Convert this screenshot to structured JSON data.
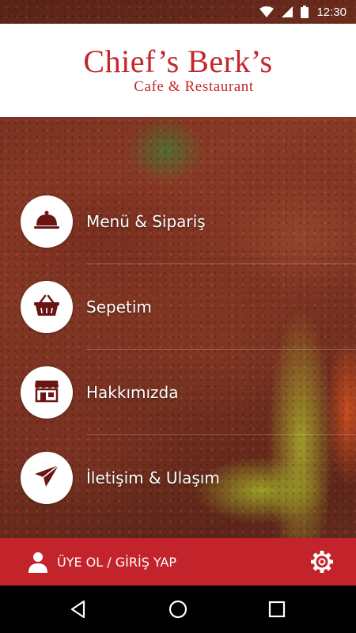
{
  "status_bar": {
    "time": "12:30",
    "icons": [
      "wifi-icon",
      "signal-icon",
      "battery-icon"
    ]
  },
  "header": {
    "brand_name": "Chief’s Berk’s",
    "brand_subtitle": "Cafe & Restaurant",
    "brand_color": "#c3262b"
  },
  "menu": {
    "items": [
      {
        "label": "Menü & Sipariş",
        "icon": "cloche-icon"
      },
      {
        "label": "Sepetim",
        "icon": "basket-icon"
      },
      {
        "label": "Hakkımızda",
        "icon": "storefront-icon"
      },
      {
        "label": "İletişim & Ulaşım",
        "icon": "paper-plane-icon"
      }
    ],
    "icon_color": "#6b1414"
  },
  "account_bar": {
    "label": "ÜYE OL / GİRİŞ YAP",
    "background": "#c3232a",
    "icons": [
      "user-icon",
      "settings-gear-icon"
    ]
  },
  "nav_bar": {
    "buttons": [
      "back-icon",
      "home-icon",
      "recents-icon"
    ]
  }
}
